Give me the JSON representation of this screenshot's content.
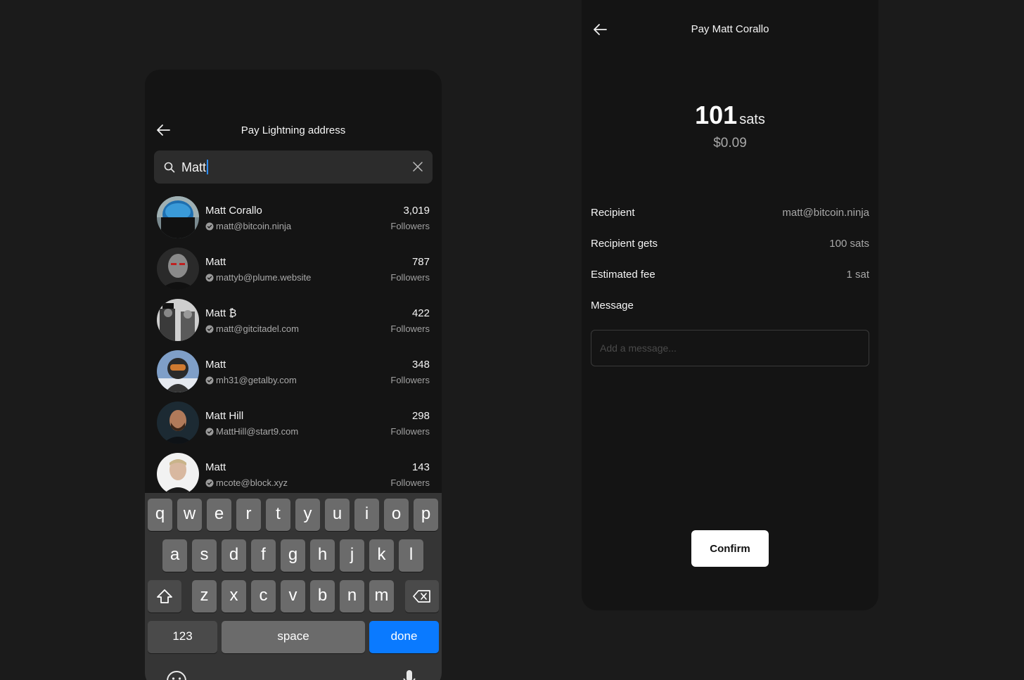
{
  "colors": {
    "background": "#1b1b1b",
    "panel": "#141414",
    "accent": "#0a7aff",
    "muted": "#a8a8a8"
  },
  "search_screen": {
    "title": "Pay Lightning address",
    "back_icon": "arrow-left-icon",
    "search": {
      "icon": "search-icon",
      "value": "Matt",
      "clear_icon": "close-icon"
    },
    "results": [
      {
        "name": "Matt Corallo",
        "address": "matt@bitcoin.ninja",
        "count": "3,019",
        "label": "Followers"
      },
      {
        "name": "Matt",
        "address": "mattyb@plume.website",
        "count": "787",
        "label": "Followers"
      },
      {
        "name": "Matt ₿",
        "address": "matt@gitcitadel.com",
        "count": "422",
        "label": "Followers"
      },
      {
        "name": "Matt",
        "address": "mh31@getalby.com",
        "count": "348",
        "label": "Followers"
      },
      {
        "name": "Matt Hill",
        "address": "MattHill@start9.com",
        "count": "298",
        "label": "Followers"
      },
      {
        "name": "Matt",
        "address": "mcote@block.xyz",
        "count": "143",
        "label": "Followers"
      }
    ],
    "keyboard": {
      "row1": [
        "q",
        "w",
        "e",
        "r",
        "t",
        "y",
        "u",
        "i",
        "o",
        "p"
      ],
      "row2": [
        "a",
        "s",
        "d",
        "f",
        "g",
        "h",
        "j",
        "k",
        "l"
      ],
      "row3": [
        "z",
        "x",
        "c",
        "v",
        "b",
        "n",
        "m"
      ],
      "numbers_key": "123",
      "space_key": "space",
      "done_key": "done",
      "shift_icon": "shift-icon",
      "delete_icon": "backspace-icon"
    }
  },
  "pay_screen": {
    "title": "Pay Matt Corallo",
    "back_icon": "arrow-left-icon",
    "amount": "101",
    "amount_unit": "sats",
    "fiat": "$0.09",
    "details": [
      {
        "label": "Recipient",
        "value": "matt@bitcoin.ninja"
      },
      {
        "label": "Recipient gets",
        "value": "100 sats"
      },
      {
        "label": "Estimated fee",
        "value": "1 sat"
      }
    ],
    "message_label": "Message",
    "message_placeholder": "Add a message...",
    "confirm_label": "Confirm"
  }
}
